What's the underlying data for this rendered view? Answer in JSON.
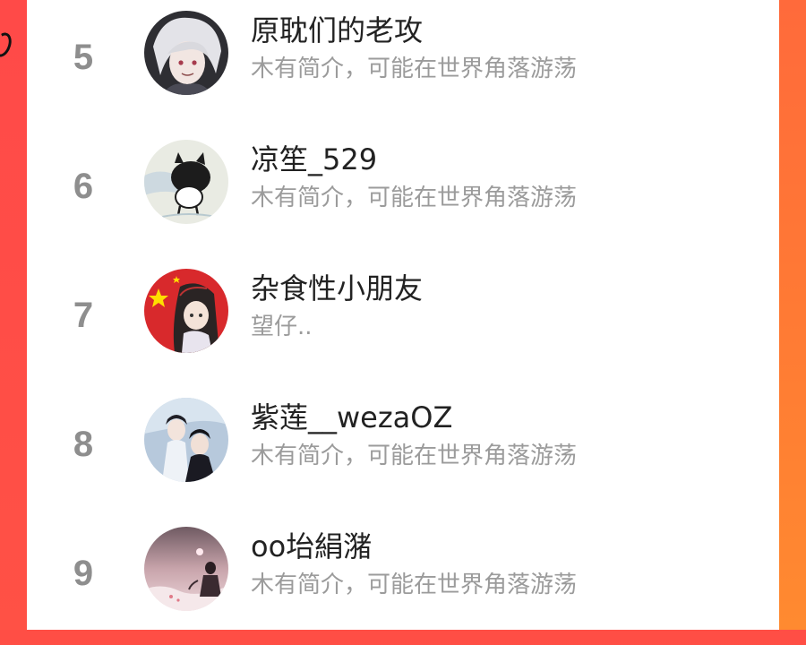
{
  "list": {
    "items": [
      {
        "rank": "5",
        "name": "原耽们的老攻",
        "bio": "木有简介，可能在世界角落游荡",
        "avatar_icon": "avatar-white-haired-character"
      },
      {
        "rank": "6",
        "name": "凉笙_529",
        "bio": "木有简介，可能在世界角落游荡",
        "avatar_icon": "avatar-cartoon-pig"
      },
      {
        "rank": "7",
        "name": "杂食性小朋友",
        "bio": "望仔..",
        "avatar_icon": "avatar-flag-character"
      },
      {
        "rank": "8",
        "name": "紫莲__wezaOZ",
        "bio": "木有简介，可能在世界角落游荡",
        "avatar_icon": "avatar-two-characters"
      },
      {
        "rank": "9",
        "name": "oo坮絹潴",
        "bio": "木有简介，可能在世界角落游荡",
        "avatar_icon": "avatar-pink-sky-figure"
      }
    ]
  },
  "colors": {
    "background_red": "#ff4e45",
    "background_orange": "#ff7a33",
    "rank_gray": "#8e8e8e",
    "name_text": "#222222",
    "bio_text": "#9b9b9b"
  }
}
